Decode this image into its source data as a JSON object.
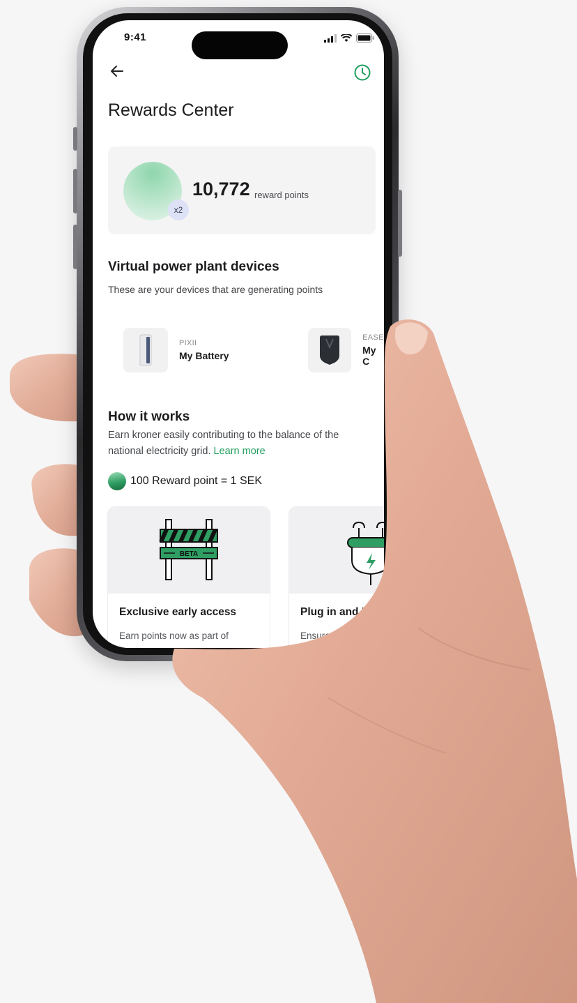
{
  "status_bar": {
    "time": "9:41"
  },
  "header": {
    "title": "Rewards Center"
  },
  "points": {
    "value": "10,772",
    "unit": "reward points",
    "multiplier": "x2"
  },
  "devices_section": {
    "title": "Virtual power plant devices",
    "subtitle": "These are your devices that are generating points",
    "devices": [
      {
        "brand": "PIXII",
        "name": "My Battery",
        "icon": "battery-device-icon"
      },
      {
        "brand": "EASE",
        "name": "My C",
        "icon": "charger-device-icon"
      }
    ]
  },
  "how_it_works": {
    "title": "How it works",
    "text_line1": "Earn kroner easily contributing to the balance of the",
    "text_line2": "national electricity grid.",
    "learn_more": "Learn more",
    "rate": "100 Reward point = 1 SEK"
  },
  "cards": [
    {
      "title": "Exclusive early access",
      "text": "Earn points now as part of",
      "badge": "BETA",
      "icon": "beta-barrier-icon"
    },
    {
      "title": "Plug in and P",
      "text": "Ensure your",
      "icon": "plug-icon"
    }
  ],
  "colors": {
    "accent": "#1f9d5c",
    "stripe": "#2f9e62",
    "card_bg": "#f4f4f5"
  }
}
